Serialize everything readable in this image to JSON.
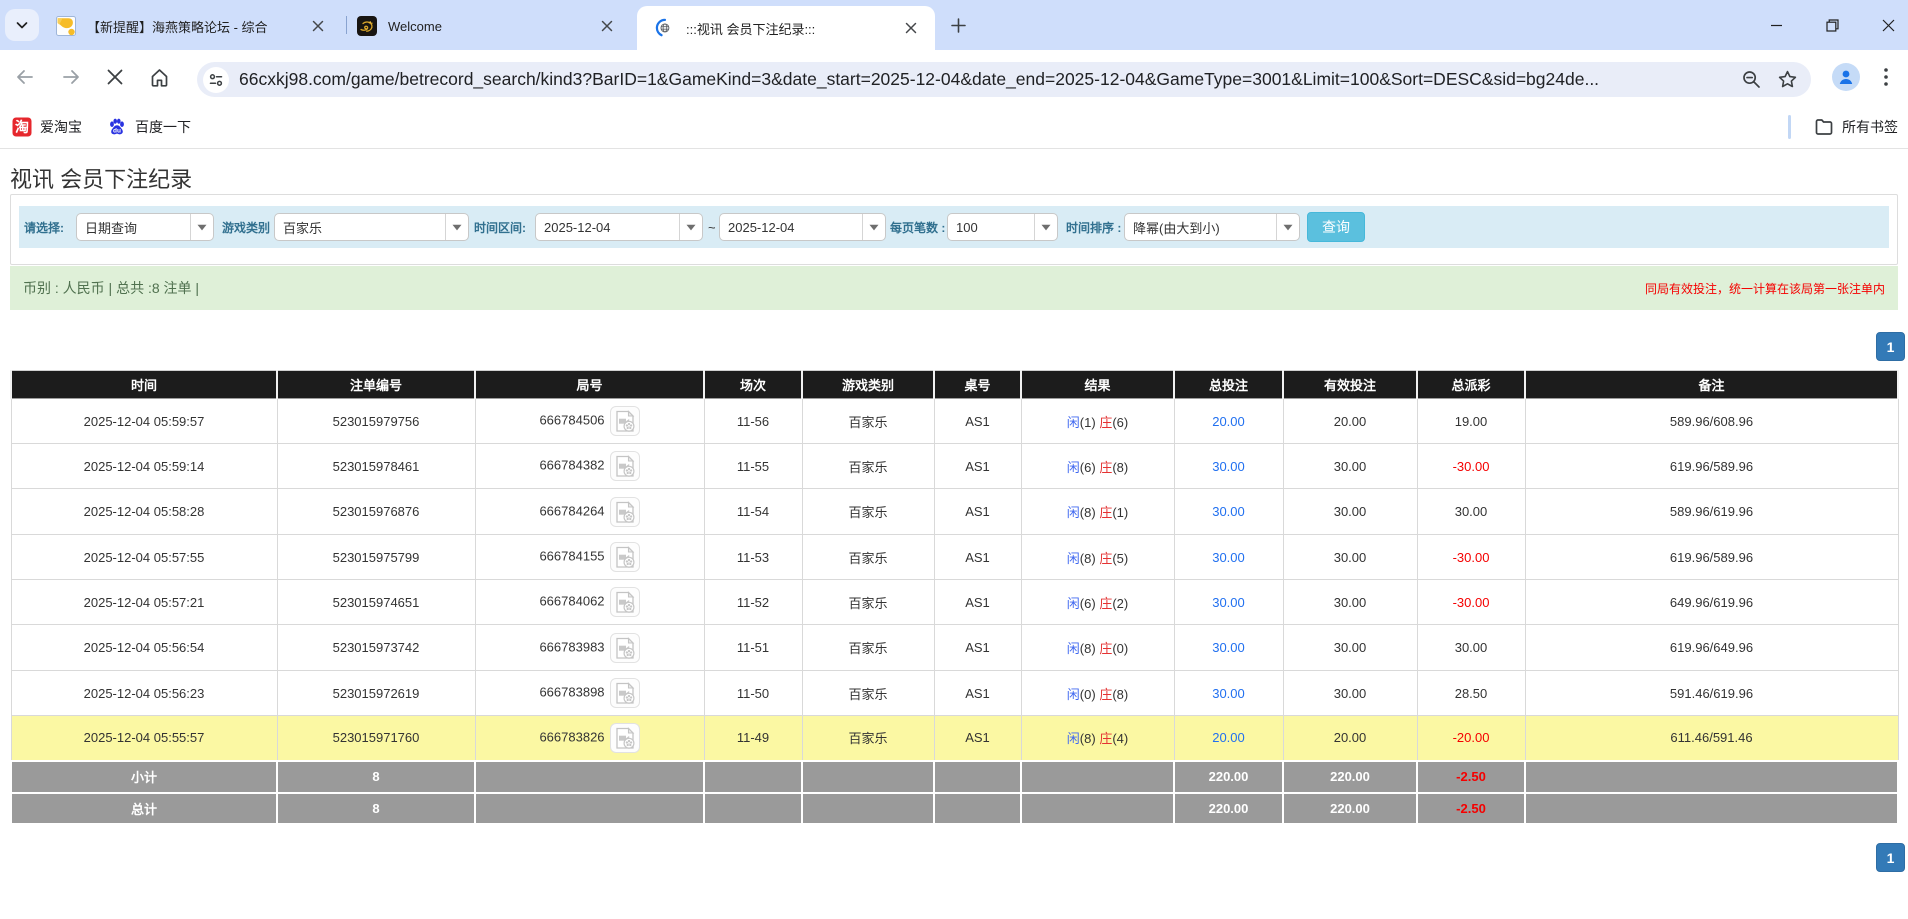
{
  "browser": {
    "tabs": [
      {
        "title": "【新提醒】海燕策略论坛 - 综合",
        "active": false,
        "favicon": "seagull-forum"
      },
      {
        "title": "Welcome",
        "active": false,
        "favicon": "gold-dragon"
      },
      {
        "title": ":::视讯 会员下注纪录:::",
        "active": true,
        "favicon": "loading-globe"
      }
    ],
    "url": "66cxkj98.com/game/betrecord_search/kind3?BarID=1&GameKind=3&date_start=2025-12-04&date_end=2025-12-04&GameType=3001&Limit=100&Sort=DESC&sid=bg24de...",
    "bookmarks": [
      {
        "label": "爱淘宝",
        "favicon": "taobao"
      },
      {
        "label": "百度一下",
        "favicon": "baidu"
      }
    ],
    "all_bookmarks_label": "所有书签"
  },
  "page": {
    "title": "视讯 会员下注纪录",
    "filters": {
      "select_label": "请选择:",
      "select_value": "日期查询",
      "game_type_label": "游戏类别",
      "game_type_value": "百家乐",
      "date_range_label": "时间区间:",
      "date_start": "2025-12-04",
      "date_tilde": "~",
      "date_end": "2025-12-04",
      "page_size_label": "每页笔数 :",
      "page_size_value": "100",
      "sort_label": "时间排序 :",
      "sort_value": "降幂(由大到小)",
      "query_button": "查询"
    },
    "summary_left": "币别 : 人民币 | 总共 :8 注单 |",
    "summary_right": "同局有效投注，统一计算在该局第一张注单内",
    "pagination": "1"
  },
  "table": {
    "headers": [
      "时间",
      "注单编号",
      "局号",
      "场次",
      "游戏类别",
      "桌号",
      "结果",
      "总投注",
      "有效投注",
      "总派彩",
      "备注"
    ],
    "rows": [
      {
        "time": "2025-12-04 05:59:57",
        "bet_id": "523015979756",
        "round": "666784506",
        "session": "11-56",
        "game": "百家乐",
        "table": "AS1",
        "xian": "闲",
        "xian_n": "(1)",
        "zhuang": "庄",
        "zhuang_n": "(6)",
        "total_bet": "20.00",
        "valid_bet": "20.00",
        "payout": "19.00",
        "payout_neg": false,
        "note": "589.96/608.96",
        "hl": false
      },
      {
        "time": "2025-12-04 05:59:14",
        "bet_id": "523015978461",
        "round": "666784382",
        "session": "11-55",
        "game": "百家乐",
        "table": "AS1",
        "xian": "闲",
        "xian_n": "(6)",
        "zhuang": "庄",
        "zhuang_n": "(8)",
        "total_bet": "30.00",
        "valid_bet": "30.00",
        "payout": "-30.00",
        "payout_neg": true,
        "note": "619.96/589.96",
        "hl": false
      },
      {
        "time": "2025-12-04 05:58:28",
        "bet_id": "523015976876",
        "round": "666784264",
        "session": "11-54",
        "game": "百家乐",
        "table": "AS1",
        "xian": "闲",
        "xian_n": "(8)",
        "zhuang": "庄",
        "zhuang_n": "(1)",
        "total_bet": "30.00",
        "valid_bet": "30.00",
        "payout": "30.00",
        "payout_neg": false,
        "note": "589.96/619.96",
        "hl": false
      },
      {
        "time": "2025-12-04 05:57:55",
        "bet_id": "523015975799",
        "round": "666784155",
        "session": "11-53",
        "game": "百家乐",
        "table": "AS1",
        "xian": "闲",
        "xian_n": "(8)",
        "zhuang": "庄",
        "zhuang_n": "(5)",
        "total_bet": "30.00",
        "valid_bet": "30.00",
        "payout": "-30.00",
        "payout_neg": true,
        "note": "619.96/589.96",
        "hl": false
      },
      {
        "time": "2025-12-04 05:57:21",
        "bet_id": "523015974651",
        "round": "666784062",
        "session": "11-52",
        "game": "百家乐",
        "table": "AS1",
        "xian": "闲",
        "xian_n": "(6)",
        "zhuang": "庄",
        "zhuang_n": "(2)",
        "total_bet": "30.00",
        "valid_bet": "30.00",
        "payout": "-30.00",
        "payout_neg": true,
        "note": "649.96/619.96",
        "hl": false
      },
      {
        "time": "2025-12-04 05:56:54",
        "bet_id": "523015973742",
        "round": "666783983",
        "session": "11-51",
        "game": "百家乐",
        "table": "AS1",
        "xian": "闲",
        "xian_n": "(8)",
        "zhuang": "庄",
        "zhuang_n": "(0)",
        "total_bet": "30.00",
        "valid_bet": "30.00",
        "payout": "30.00",
        "payout_neg": false,
        "note": "619.96/649.96",
        "hl": false
      },
      {
        "time": "2025-12-04 05:56:23",
        "bet_id": "523015972619",
        "round": "666783898",
        "session": "11-50",
        "game": "百家乐",
        "table": "AS1",
        "xian": "闲",
        "xian_n": "(0)",
        "zhuang": "庄",
        "zhuang_n": "(8)",
        "total_bet": "30.00",
        "valid_bet": "30.00",
        "payout": "28.50",
        "payout_neg": false,
        "note": "591.46/619.96",
        "hl": false
      },
      {
        "time": "2025-12-04 05:55:57",
        "bet_id": "523015971760",
        "round": "666783826",
        "session": "11-49",
        "game": "百家乐",
        "table": "AS1",
        "xian": "闲",
        "xian_n": "(8)",
        "zhuang": "庄",
        "zhuang_n": "(4)",
        "total_bet": "20.00",
        "valid_bet": "20.00",
        "payout": "-20.00",
        "payout_neg": true,
        "note": "611.46/591.46",
        "hl": true
      }
    ],
    "subtotal": {
      "label": "小计",
      "count": "8",
      "total_bet": "220.00",
      "valid_bet": "220.00",
      "payout": "-2.50"
    },
    "grand_total": {
      "label": "总计",
      "count": "8",
      "total_bet": "220.00",
      "valid_bet": "220.00",
      "payout": "-2.50"
    }
  }
}
